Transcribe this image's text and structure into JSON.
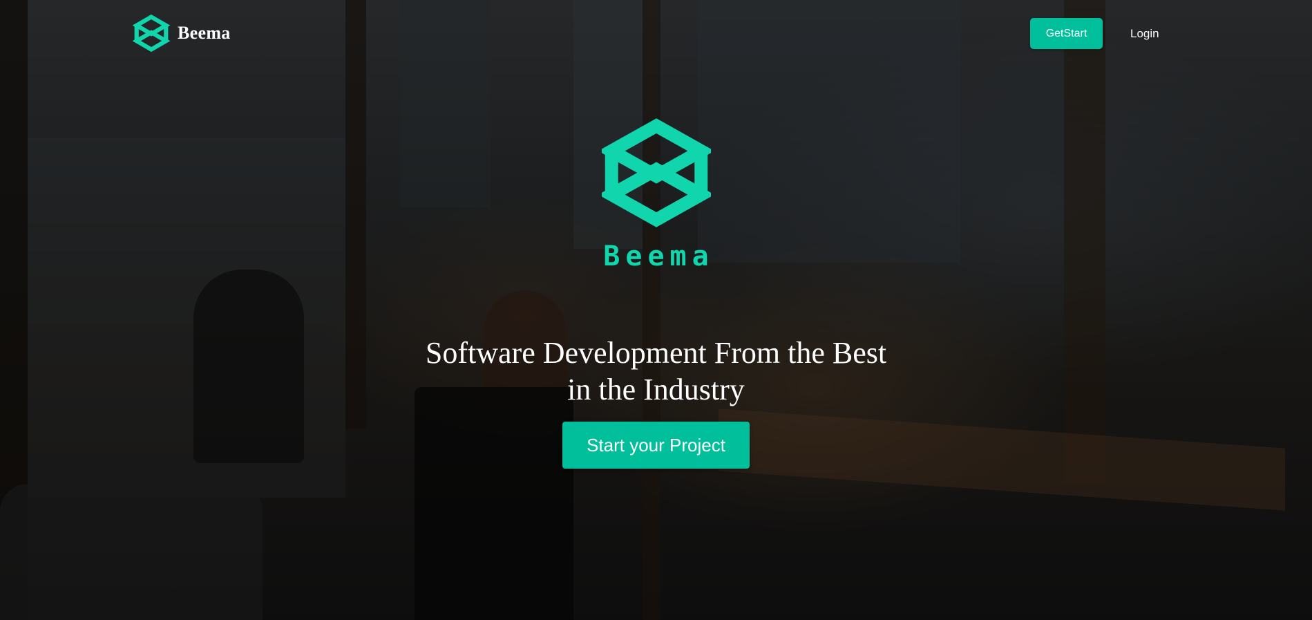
{
  "brand": {
    "name": "Beema",
    "logo_icon": "beema-cube-icon",
    "accent_color": "#00bf9a"
  },
  "nav": {
    "get_start_label": "GetStart",
    "login_label": "Login"
  },
  "hero": {
    "logo_icon": "beema-cube-icon",
    "logo_text": "Beema",
    "headline_line1": "Software Development From the Best",
    "headline_line2": "in the Industry",
    "cta_label": "Start your Project",
    "background_image": "office-cityscape-photo"
  }
}
